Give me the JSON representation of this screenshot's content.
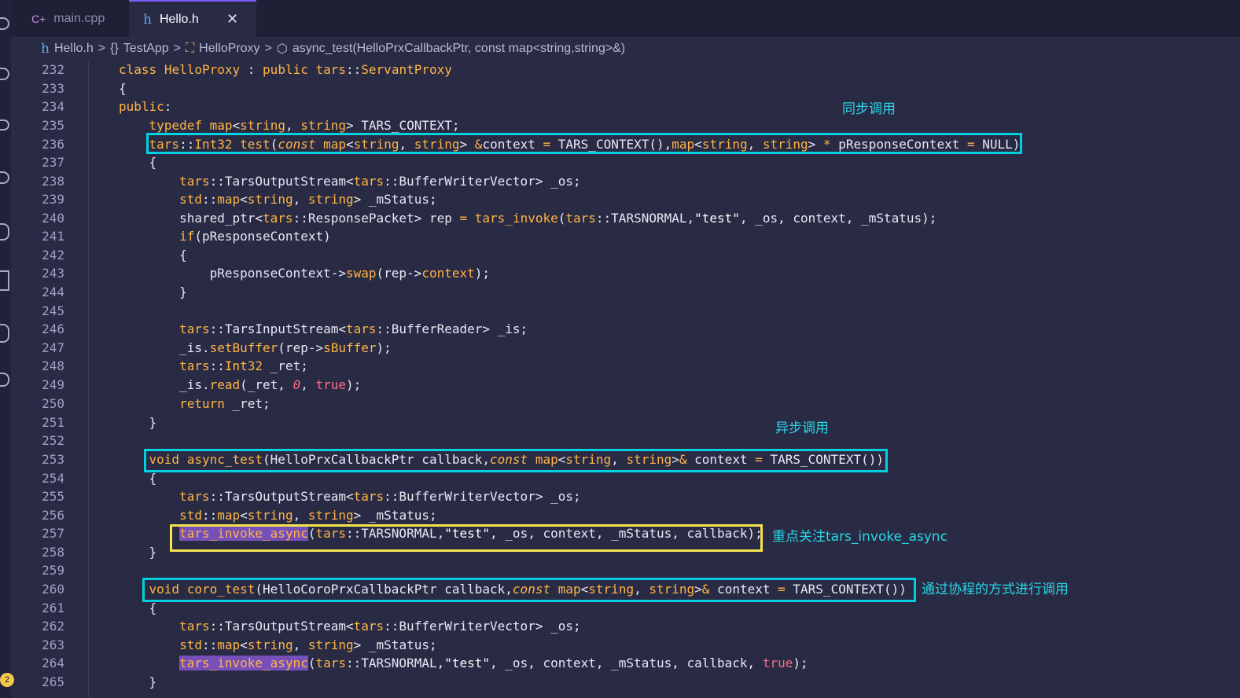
{
  "tabs": [
    {
      "label": "main.cpp",
      "icon": "c++-file-icon",
      "glyph": "C+"
    },
    {
      "label": "Hello.h",
      "icon": "header-file-icon",
      "glyph": "h",
      "close": "✕"
    }
  ],
  "breadcrumb": [
    {
      "icon_glyph": "h",
      "label": "Hello.h"
    },
    {
      "icon_glyph": "{}",
      "label": "TestApp"
    },
    {
      "icon_glyph": "⛶",
      "label": "HelloProxy"
    },
    {
      "icon_glyph": "⬡",
      "label": "async_test(HelloPrxCallbackPtr, const map<string,string>&)"
    }
  ],
  "separator": ">",
  "notification_count": "2",
  "line_numbers": [
    "232",
    "233",
    "234",
    "235",
    "236",
    "237",
    "238",
    "239",
    "240",
    "241",
    "242",
    "243",
    "244",
    "245",
    "246",
    "247",
    "248",
    "249",
    "250",
    "251",
    "252",
    "253",
    "254",
    "255",
    "256",
    "257",
    "258",
    "259",
    "260",
    "261",
    "262",
    "263",
    "264",
    "265"
  ],
  "annotations": {
    "sync": "同步调用",
    "async": "异步调用",
    "focus": "重点关注tars_invoke_async",
    "coro": "通过协程的方式进行调用"
  },
  "colors": {
    "accent_box": "#00d0e0",
    "focus_box": "#f4e44c",
    "keyword": "#ffb545",
    "highlight": "#7650b8"
  }
}
